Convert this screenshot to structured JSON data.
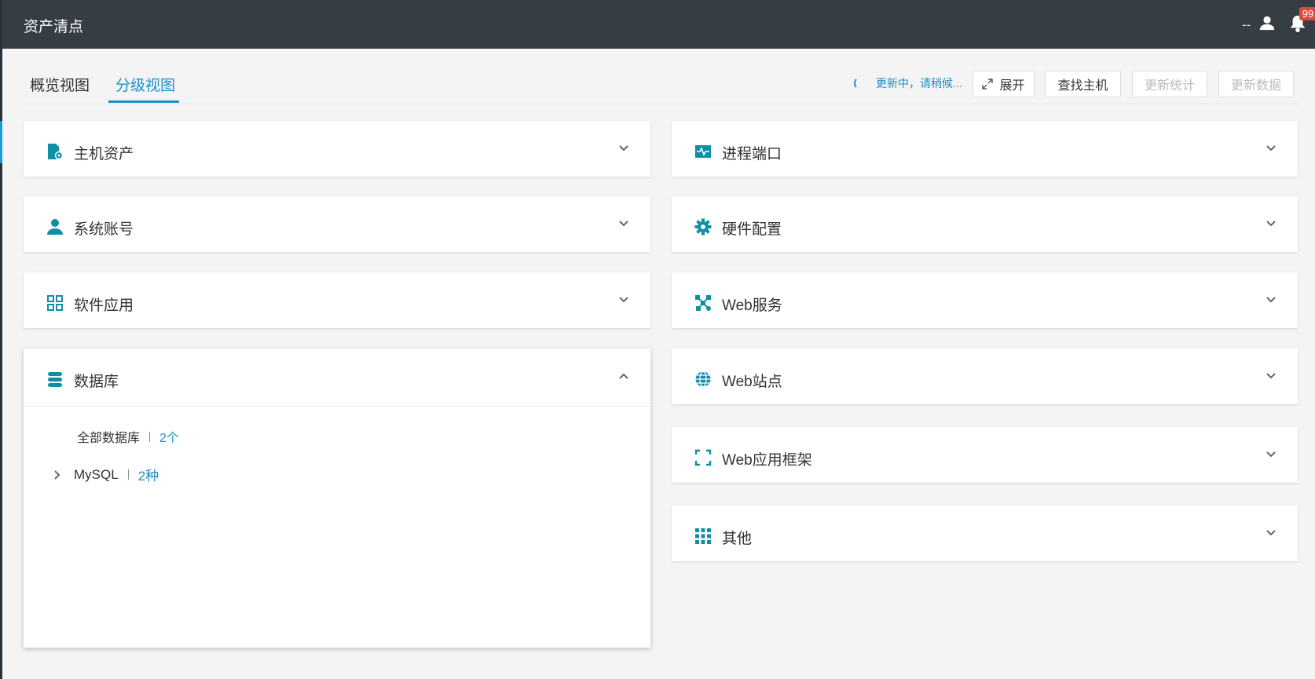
{
  "app": {
    "title": "资产清点"
  },
  "user": {
    "name": "--",
    "notifications": "99"
  },
  "tabs": [
    {
      "label": "概览视图",
      "active": false
    },
    {
      "label": "分级视图",
      "active": true
    }
  ],
  "toolbar": {
    "loading_text": "更新中，请稍候...",
    "expand_label": "展开",
    "find_host_label": "查找主机",
    "update_stats_label": "更新统计",
    "update_data_label": "更新数据"
  },
  "colors": {
    "accent": "#1a8fc6",
    "topbar": "#373d45",
    "badge": "#e0483e",
    "icon": "#0f8fa6"
  },
  "cards_left": [
    {
      "title": "主机资产",
      "icon": "host-gear-icon",
      "expanded": false
    },
    {
      "title": "系统账号",
      "icon": "user-icon",
      "expanded": false
    },
    {
      "title": "软件应用",
      "icon": "apps-grid-icon",
      "expanded": false
    },
    {
      "title": "数据库",
      "icon": "database-icon",
      "expanded": true
    }
  ],
  "cards_right": [
    {
      "title": "进程端口",
      "icon": "activity-icon",
      "expanded": false
    },
    {
      "title": "硬件配置",
      "icon": "gear-icon",
      "expanded": false
    },
    {
      "title": "Web服务",
      "icon": "network-icon",
      "expanded": false
    },
    {
      "title": "Web站点",
      "icon": "globe-icon",
      "expanded": false
    },
    {
      "title": "Web应用框架",
      "icon": "frame-icon",
      "expanded": false
    },
    {
      "title": "其他",
      "icon": "dots-grid-icon",
      "expanded": false
    }
  ],
  "database": {
    "all_label": "全部数据库",
    "all_count": "2个",
    "items": [
      {
        "name": "MySQL",
        "count": "2种"
      }
    ]
  }
}
